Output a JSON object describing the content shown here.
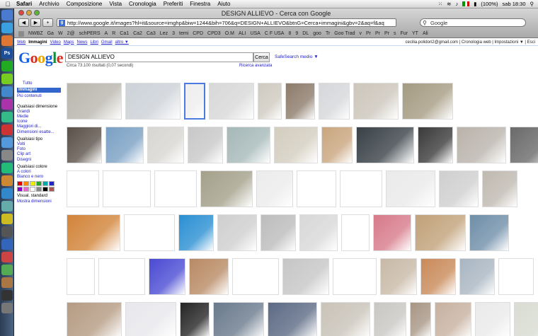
{
  "menubar": {
    "items": [
      "Safari",
      "Archivio",
      "Composizione",
      "Vista",
      "Cronologia",
      "Preferiti",
      "Finestra",
      "Aiuto"
    ],
    "battery": "(100%)",
    "clock": "sab 18:30"
  },
  "window": {
    "title": "DESIGN ALLIEVO - Cerca con Google",
    "url": "http://www.google.it/images?hl=it&source=imghp&biw=1244&bih=706&q=DESIGN+ALLIEVO&btnG=Cerca+immagini&gbv=2&aq=f&aq",
    "search_placeholder": "Google"
  },
  "bookmarks": [
    "NWBZ",
    "Ga",
    "W",
    "2@",
    "schPERS",
    "A",
    "R",
    "Ca1",
    "Ca2",
    "Ca3",
    "Lez",
    "3",
    "temi",
    "CPD",
    "CPD3",
    "O.M",
    "ALI",
    "USA",
    "C F USA",
    "8",
    "9",
    "DL",
    "goo",
    "Tr",
    "Goo Trad",
    "v",
    "Pr",
    "Pr",
    "Pr",
    "s",
    "Fur",
    "YT",
    "Ali"
  ],
  "gbar": {
    "links": [
      "Web",
      "Immagini",
      "Video",
      "Maps",
      "News",
      "Libri",
      "Gmail",
      "altro ▼"
    ],
    "right": "cecilia.polidori2@gmail.com | Cronologia web | Impostazioni ▼ | Esci"
  },
  "search": {
    "logo": "Google",
    "query": "DESIGN ALLIEVO",
    "button": "Cerca",
    "safesearch": "SafeSearch medio ▼",
    "stats": "Circa 73.100 risultati (0,07 secondi)",
    "advanced": "Ricerca avanzata"
  },
  "sidebar": {
    "types": [
      "Tutto",
      "Immagini",
      "Più contenuti"
    ],
    "size_header": "Qualsiasi dimensione",
    "sizes": [
      "Grandi",
      "Medie",
      "Icone",
      "Maggiori di...",
      "Dimensioni esatte..."
    ],
    "type_header": "Qualsiasi tipo",
    "img_types": [
      "Volti",
      "Foto",
      "Clip art",
      "Disegni"
    ],
    "color_header": "Qualsiasi colore",
    "colors": [
      "A colori",
      "Bianco e nero"
    ],
    "swatch_colors": [
      "#d00",
      "#f80",
      "#ee0",
      "#2a2",
      "#0aa",
      "#22c",
      "#80c",
      "#e6c",
      "#fff",
      "#888",
      "#000",
      "#a55"
    ],
    "view_header": "Visual. standard",
    "view_link": "Mostra dimensioni"
  },
  "dock": {
    "icons": [
      {
        "label": "",
        "color": "#4a7bd1"
      },
      {
        "label": "",
        "color": "#3aa0e0"
      },
      {
        "label": "",
        "color": "#d73"
      },
      {
        "label": "Ps",
        "color": "#1d4e99"
      },
      {
        "label": "",
        "color": "#2a2"
      },
      {
        "label": "",
        "color": "#7c2"
      },
      {
        "label": "",
        "color": "#48c"
      },
      {
        "label": "",
        "color": "#a3a"
      },
      {
        "label": "",
        "color": "#3b8"
      },
      {
        "label": "",
        "color": "#c33"
      },
      {
        "label": "",
        "color": "#59d"
      },
      {
        "label": "",
        "color": "#888"
      },
      {
        "label": "",
        "color": "#2b7"
      },
      {
        "label": "",
        "color": "#c83"
      },
      {
        "label": "",
        "color": "#38c"
      },
      {
        "label": "",
        "color": "#6aa"
      },
      {
        "label": "",
        "color": "#cb2"
      },
      {
        "label": "",
        "color": "#555"
      },
      {
        "label": "",
        "color": "#36b"
      },
      {
        "label": "",
        "color": "#c44"
      },
      {
        "label": "",
        "color": "#5a5"
      },
      {
        "label": "",
        "color": "#a74"
      },
      {
        "label": "",
        "color": "#333"
      },
      {
        "label": "",
        "color": "#777"
      }
    ]
  },
  "images": {
    "rows": [
      [
        "#b9b6ad",
        "#cdd2d8",
        "#eeeeee",
        "#d8d8d8",
        "#cfcac0",
        "#8c7b6a",
        "#d5d7da",
        "#ccc6bb",
        "#a59b82"
      ],
      [
        "#5a5048",
        "#7aa0c4",
        "#d8d6d2",
        "#c8c8c8",
        "#a6b8b8",
        "#d3cdbf",
        "#c9a57e",
        "#394147",
        "#3a3a3a",
        "#b9b3ab",
        "#6a6a6a"
      ],
      [
        "#444",
        "#777",
        "#999",
        "#a3a08a",
        "#ececec",
        "#c23",
        "#d34",
        "#eaeaea",
        "#d0cfcf",
        "#bfb9b0"
      ],
      [
        "#d2843a",
        "#999",
        "#2a8fd3",
        "#cfcfcf",
        "#bcbcbc",
        "#d8d8d8",
        "#888",
        "#d77a8a",
        "#c1a27a",
        "#6f8ea8"
      ],
      [
        "#999",
        "#666",
        "#4a4bd3",
        "#b88a64",
        "#444",
        "#c6c6c6",
        "#888",
        "#c8b9a6",
        "#c98a59",
        "#a9b6c2",
        "#888"
      ],
      [
        "#b59b83",
        "#e8e8ec",
        "#242424",
        "#6a7a8c",
        "#5c6a84",
        "#c9c3b8",
        "#c9c7c4",
        "#a79685",
        "#c7b1a0",
        "#eaeaea",
        "#d9dcd2"
      ]
    ]
  }
}
